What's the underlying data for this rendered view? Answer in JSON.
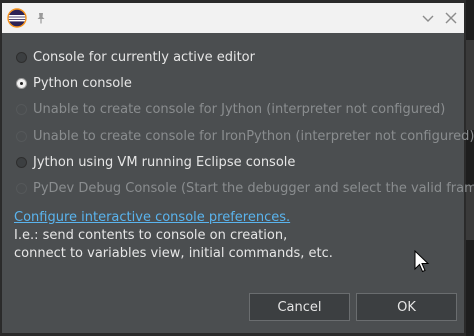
{
  "options": [
    {
      "label": "Console for currently active editor",
      "state": "unchecked",
      "enabled": true
    },
    {
      "label": "Python console",
      "state": "checked",
      "enabled": true
    },
    {
      "label": "Unable to create console for Jython (interpreter not configured)",
      "state": "unchecked",
      "enabled": false
    },
    {
      "label": "Unable to create console for IronPython (interpreter not configured)",
      "state": "unchecked",
      "enabled": false
    },
    {
      "label": "Jython using VM running Eclipse console",
      "state": "unchecked",
      "enabled": true
    },
    {
      "label": "PyDev Debug Console (Start the debugger and select the valid frame)",
      "state": "unchecked",
      "enabled": false
    }
  ],
  "preferences_link": "Configure interactive console preferences.",
  "info_lines": [
    "I.e.: send contents to console on creation,",
    "connect to variables view, initial commands, etc."
  ],
  "buttons": {
    "cancel": "Cancel",
    "ok": "OK"
  },
  "colors": {
    "dialog_bg": "#4b4e50",
    "titlebar_bg": "#f2f2f2",
    "link": "#5ab4ee",
    "text": "#e6e6e6",
    "disabled_text": "#8a8d8f"
  },
  "icons": {
    "app": "eclipse-icon",
    "pin": "pin-icon",
    "minimize": "chevron-down-icon",
    "close": "close-icon",
    "cursor": "mouse-pointer-icon"
  }
}
